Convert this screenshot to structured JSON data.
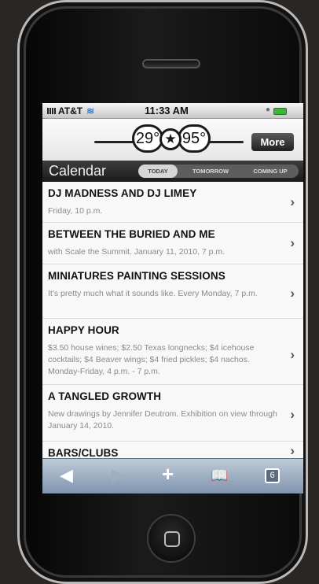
{
  "status": {
    "carrier": "AT&T",
    "time": "11:33 AM"
  },
  "weather": {
    "low": "29°",
    "high": "95°",
    "more_label": "More"
  },
  "calendar": {
    "title": "Calendar",
    "tabs": [
      "TODAY",
      "TOMORROW",
      "COMING UP"
    ],
    "active_tab": "TODAY"
  },
  "events": [
    {
      "title": "DJ MADNESS AND DJ LIMEY",
      "desc": "Friday, 10 p.m."
    },
    {
      "title": "BETWEEN THE BURIED AND ME",
      "desc": "with Scale the Summit. January 11, 2010, 7 p.m."
    },
    {
      "title": "MINIATURES PAINTING SESSIONS",
      "desc": "It's pretty much what it sounds like. Every Monday, 7 p.m."
    },
    {
      "title": "HAPPY HOUR",
      "desc": "$3.50 house wines; $2.50 Texas longnecks; $4 icehouse cocktails; $4 Beaver wings; $4 fried pickles; $4 nachos. Monday-Friday, 4 p.m. - 7 p.m."
    },
    {
      "title": "A TANGLED GROWTH",
      "desc": "New drawings by Jennifer Deutrom. Exhibition on view through January 14, 2010."
    },
    {
      "title": "BARS/CLUBS",
      "desc": ""
    }
  ],
  "toolbar": {
    "pages_count": "6"
  },
  "icons": {
    "back": "back-arrow-icon",
    "forward": "forward-arrow-icon",
    "add": "plus-icon",
    "bookmarks": "bookmarks-icon",
    "pages": "pages-icon",
    "chevron": "chevron-right-icon",
    "wifi": "wifi-icon",
    "signal": "signal-icon",
    "battery": "battery-icon",
    "weather": "star-icon"
  },
  "colors": {
    "accent_bar": "#2b2b2b",
    "battery": "#37b934",
    "toolbar": "#8ea1ba"
  }
}
